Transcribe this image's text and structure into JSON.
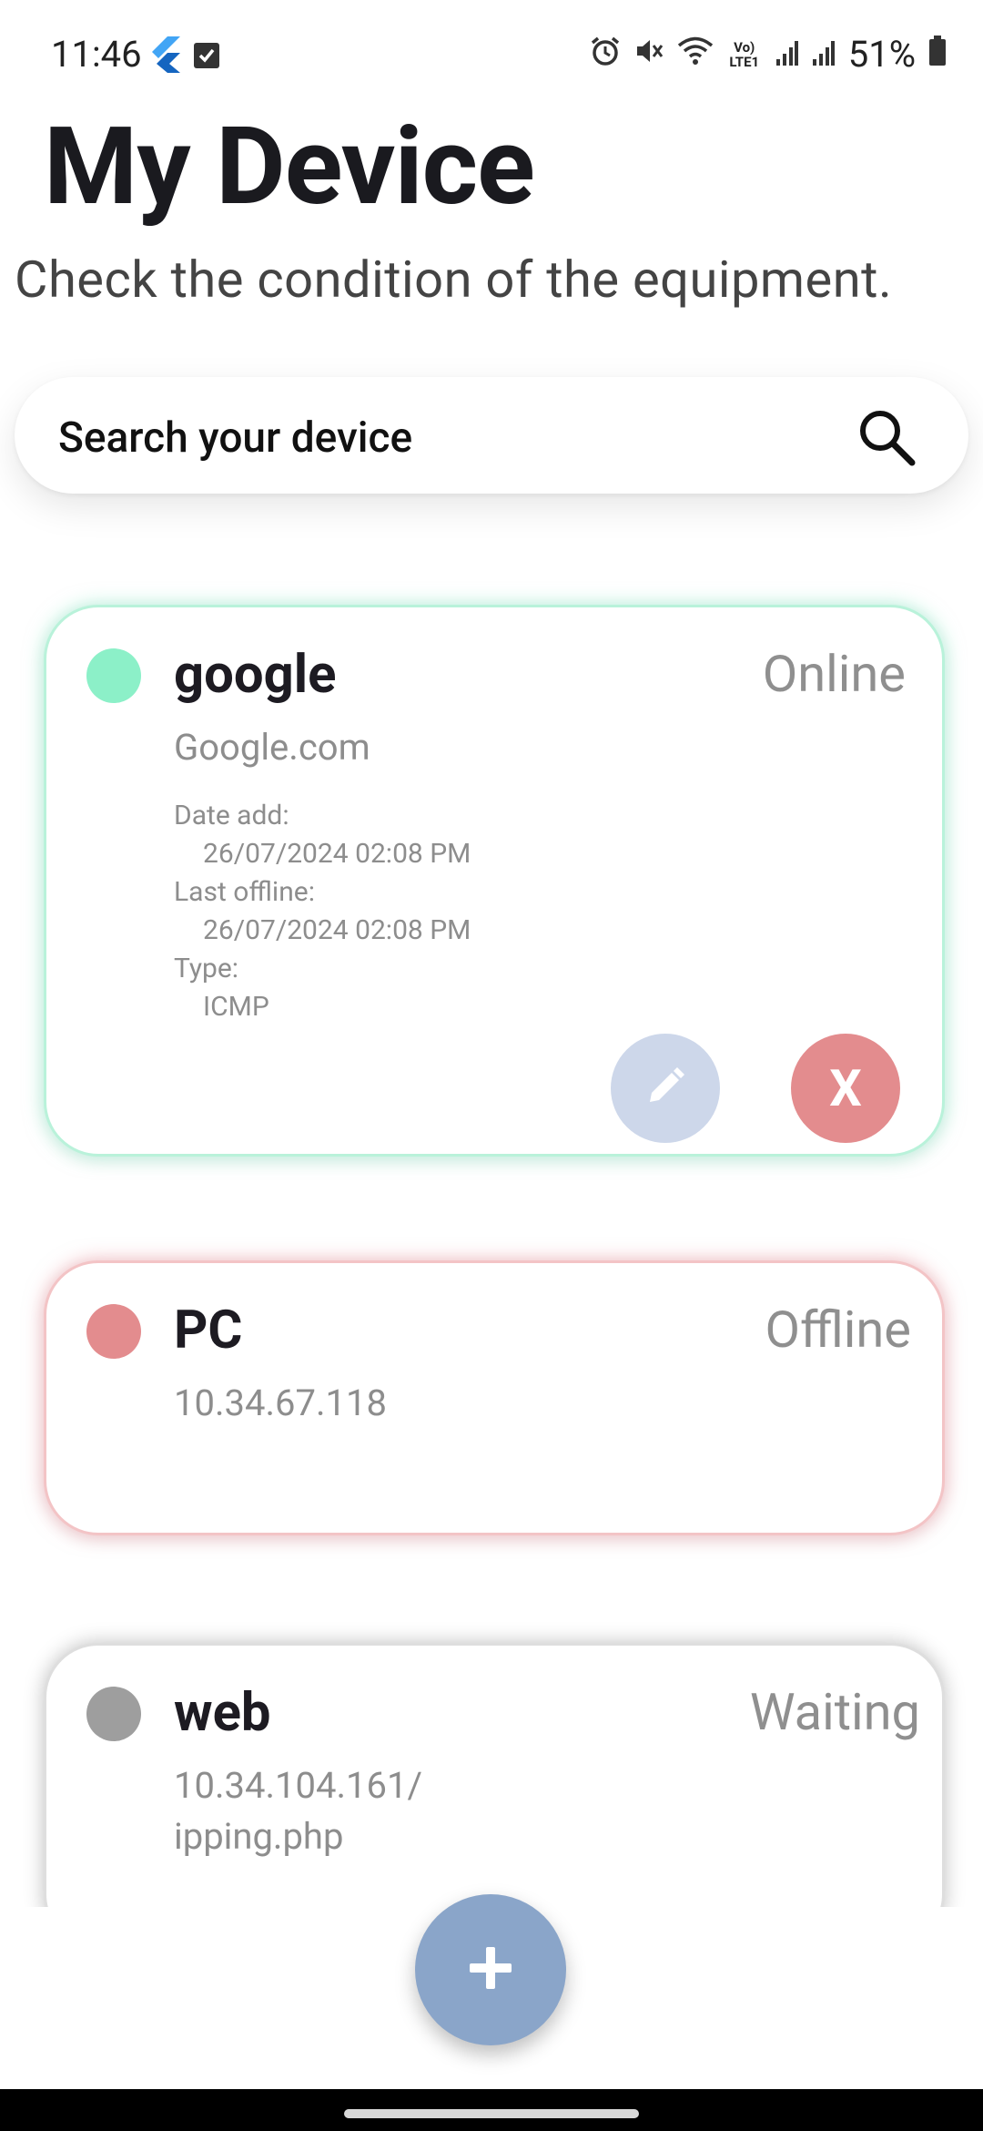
{
  "status_bar": {
    "time": "11:46",
    "battery": "51%",
    "network_label": "Vo) LTE1"
  },
  "header": {
    "title": "My Device",
    "subtitle": "Check the condition of the equipment."
  },
  "search": {
    "placeholder": "Search your device"
  },
  "devices": [
    {
      "name": "google",
      "address": "Google.com",
      "status": "Online",
      "status_color": "#8cf0c8",
      "date_add_label": "Date add:",
      "date_add": "26/07/2024 02:08 PM",
      "last_offline_label": "Last offline:",
      "last_offline": "26/07/2024 02:08 PM",
      "type_label": "Type:",
      "type": "ICMP",
      "delete_label": "X"
    },
    {
      "name": "PC",
      "address": "10.34.67.118",
      "status": "Offline",
      "status_color": "#e38c8e"
    },
    {
      "name": "web",
      "address_line1": "10.34.104.161/",
      "address_line2": "ipping.php",
      "status": "Waiting",
      "status_color": "#9e9e9e"
    }
  ],
  "fab": {
    "icon": "plus-icon"
  },
  "colors": {
    "online": "#8cf0c8",
    "offline": "#e38c8e",
    "waiting": "#9e9e9e",
    "edit_button": "#cdd7ea",
    "fab": "#8aa5c9"
  }
}
